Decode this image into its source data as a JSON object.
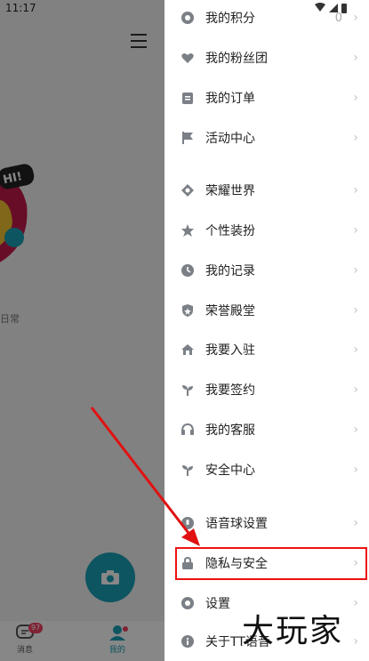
{
  "status_bar": {
    "time": "11:17"
  },
  "background": {
    "tag_text": "日常",
    "bubble_text": "HI!",
    "nav": [
      {
        "label": "消息",
        "badge": "97"
      },
      {
        "label": "我的"
      }
    ]
  },
  "menu": {
    "items": [
      {
        "label": "我的积分",
        "value": "0",
        "icon": "coin-icon"
      },
      {
        "label": "我的粉丝团",
        "icon": "heart-icon"
      },
      {
        "label": "我的订单",
        "icon": "clipboard-icon"
      },
      {
        "label": "活动中心",
        "icon": "flag-icon"
      },
      {
        "label": "荣耀世界",
        "icon": "glory-icon"
      },
      {
        "label": "个性装扮",
        "icon": "star-icon"
      },
      {
        "label": "我的记录",
        "icon": "clock-icon"
      },
      {
        "label": "荣誉殿堂",
        "icon": "shield-icon"
      },
      {
        "label": "我要入驻",
        "icon": "house-icon"
      },
      {
        "label": "我要签约",
        "icon": "sprout-icon"
      },
      {
        "label": "我的客服",
        "icon": "headset-icon"
      },
      {
        "label": "安全中心",
        "icon": "sprout-icon"
      },
      {
        "label": "语音球设置",
        "icon": "voice-ball-icon"
      },
      {
        "label": "隐私与安全",
        "icon": "lock-icon"
      },
      {
        "label": "设置",
        "icon": "gear-icon"
      },
      {
        "label": "关于TT语音",
        "icon": "info-icon"
      }
    ],
    "chevron": "›"
  },
  "watermark": "大玩家",
  "colors": {
    "highlight": "#e11111",
    "icon": "#7b8087",
    "accent": "#1aa1b5"
  }
}
